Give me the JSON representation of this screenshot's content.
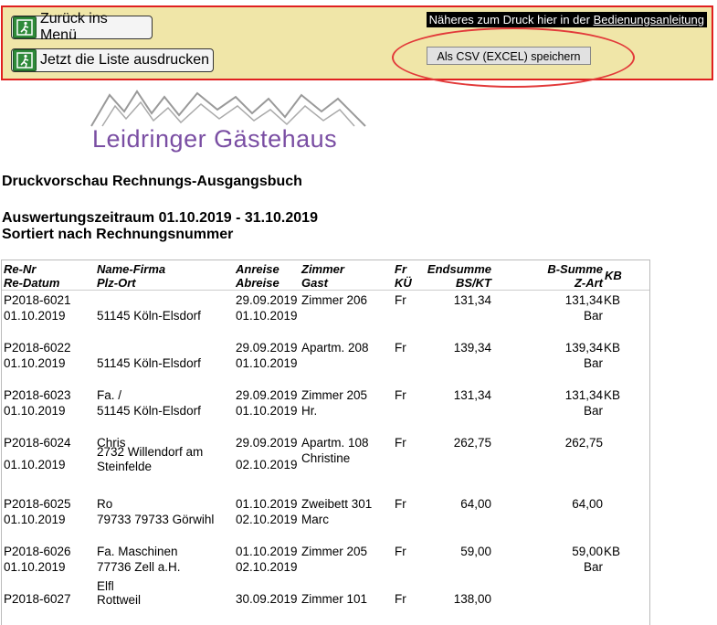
{
  "toolbar": {
    "back_label": "Zurück ins Menü",
    "print_label": "Jetzt die Liste ausdrucken",
    "info_prefix": "Näheres zum Druck hier in der ",
    "info_link": "Bedienungsanleitung",
    "csv_label": "Als CSV (EXCEL) speichern"
  },
  "logo": {
    "text": "Leidringer Gästehaus",
    "color": "#7a4ea3"
  },
  "title": "Druckvorschau Rechnungs-Ausgangsbuch",
  "period": "Auswertungszeitraum 01.10.2019 - 31.10.2019",
  "sort": "Sortiert nach Rechnungsnummer",
  "columns": {
    "renr": "Re-Nr",
    "redatum": "Re-Datum",
    "name": "Name-Firma",
    "plz": "Plz-Ort",
    "anreise": "Anreise",
    "abreise": "Abreise",
    "zimmer": "Zimmer",
    "gast": "Gast",
    "fr": "Fr",
    "ku": "KÜ",
    "endsumme": "Endsumme",
    "bskt": "BS/KT",
    "bsumme": "B-Summe",
    "zart": "Z-Art",
    "kb": "KB"
  },
  "rows": [
    {
      "renr": "P2018-6021",
      "redatum": "01.10.2019",
      "name": "",
      "plz": "51145 Köln-Elsdorf",
      "anreise": "29.09.2019",
      "abreise": "01.10.2019",
      "zimmer": "Zimmer 206",
      "gast": "",
      "fr": "Fr",
      "endsumme": "131,34",
      "bsumme": "131,34",
      "kb": "KB",
      "zart": "Bar"
    },
    {
      "renr": "P2018-6022",
      "redatum": "01.10.2019",
      "name": "",
      "plz": "51145 Köln-Elsdorf",
      "anreise": "29.09.2019",
      "abreise": "01.10.2019",
      "zimmer": "Apartm. 208",
      "gast": "",
      "fr": "Fr",
      "endsumme": "139,34",
      "bsumme": "139,34",
      "kb": "KB",
      "zart": "Bar"
    },
    {
      "renr": "P2018-6023",
      "redatum": "01.10.2019",
      "name": "Fa. /",
      "plz": "51145 Köln-Elsdorf",
      "anreise": "29.09.2019",
      "abreise": "01.10.2019",
      "zimmer": "Zimmer 205",
      "gast": "Hr.",
      "fr": "Fr",
      "endsumme": "131,34",
      "bsumme": "131,34",
      "kb": "KB",
      "zart": "Bar"
    },
    {
      "renr": "P2018-6024",
      "redatum": "01.10.2019",
      "name": "Chris",
      "plz": "2732 Willendorf am",
      "plz2": "Steinfelde",
      "anreise": "29.09.2019",
      "abreise": "02.10.2019",
      "zimmer": "Apartm. 108",
      "gast": "Christine",
      "fr": "Fr",
      "endsumme": "262,75",
      "bsumme": "262,75",
      "kb": "",
      "zart": ""
    },
    {
      "renr": "P2018-6025",
      "redatum": "01.10.2019",
      "name": "Ro",
      "plz": "79733 79733 Görwihl",
      "anreise": "01.10.2019",
      "abreise": "02.10.2019",
      "zimmer": "Zweibett 301",
      "gast": "Marc",
      "fr": "Fr",
      "endsumme": "64,00",
      "bsumme": "64,00",
      "kb": "",
      "zart": ""
    },
    {
      "renr": "P2018-6026",
      "redatum": "01.10.2019",
      "name": "Fa.          Maschinen",
      "plz": "77736 Zell a.H.",
      "anreise": "01.10.2019",
      "abreise": "02.10.2019",
      "zimmer": "Zimmer 205",
      "gast": "",
      "fr": "Fr",
      "endsumme": "59,00",
      "bsumme": "59,00",
      "kb": "KB",
      "zart": "Bar"
    },
    {
      "renr": "P2018-6027",
      "redatum": "",
      "name": "Elfl",
      "plz": "Rottweil",
      "anreise": "30.09.2019",
      "abreise": "",
      "zimmer": "Zimmer 101",
      "gast": "",
      "fr": "Fr",
      "endsumme": "138,00",
      "bsumme": "",
      "kb": "",
      "zart": ""
    }
  ]
}
